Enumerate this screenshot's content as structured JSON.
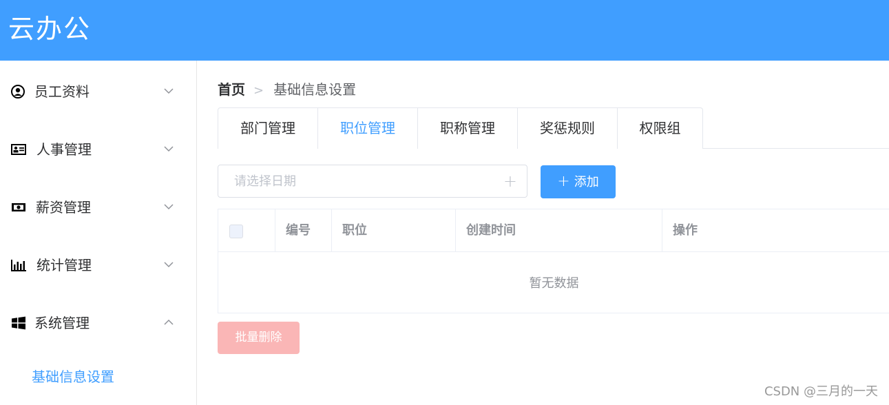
{
  "app": {
    "title": "云办公"
  },
  "sidebar": {
    "items": [
      {
        "label": "员工资料",
        "icon": "user-circle-icon",
        "expanded": false
      },
      {
        "label": "人事管理",
        "icon": "id-card-icon",
        "expanded": false
      },
      {
        "label": "薪资管理",
        "icon": "money-icon",
        "expanded": false
      },
      {
        "label": "统计管理",
        "icon": "bar-chart-icon",
        "expanded": false
      },
      {
        "label": "系统管理",
        "icon": "windows-icon",
        "expanded": true
      }
    ],
    "submenu": {
      "label": "基础信息设置"
    }
  },
  "breadcrumb": {
    "home": "首页",
    "separator": ">",
    "current": "基础信息设置"
  },
  "tabs": [
    {
      "label": "部门管理",
      "active": false
    },
    {
      "label": "职位管理",
      "active": true
    },
    {
      "label": "职称管理",
      "active": false
    },
    {
      "label": "奖惩规则",
      "active": false
    },
    {
      "label": "权限组",
      "active": false
    }
  ],
  "toolbar": {
    "date_placeholder": "请选择日期",
    "add_label": "添加"
  },
  "table": {
    "columns": [
      "编号",
      "职位",
      "创建时间",
      "操作"
    ],
    "empty_text": "暂无数据"
  },
  "batch_delete_label": "批量删除",
  "watermark": "CSDN @三月的一天",
  "colors": {
    "primary": "#409eff",
    "danger_disabled": "#fab6b6"
  }
}
